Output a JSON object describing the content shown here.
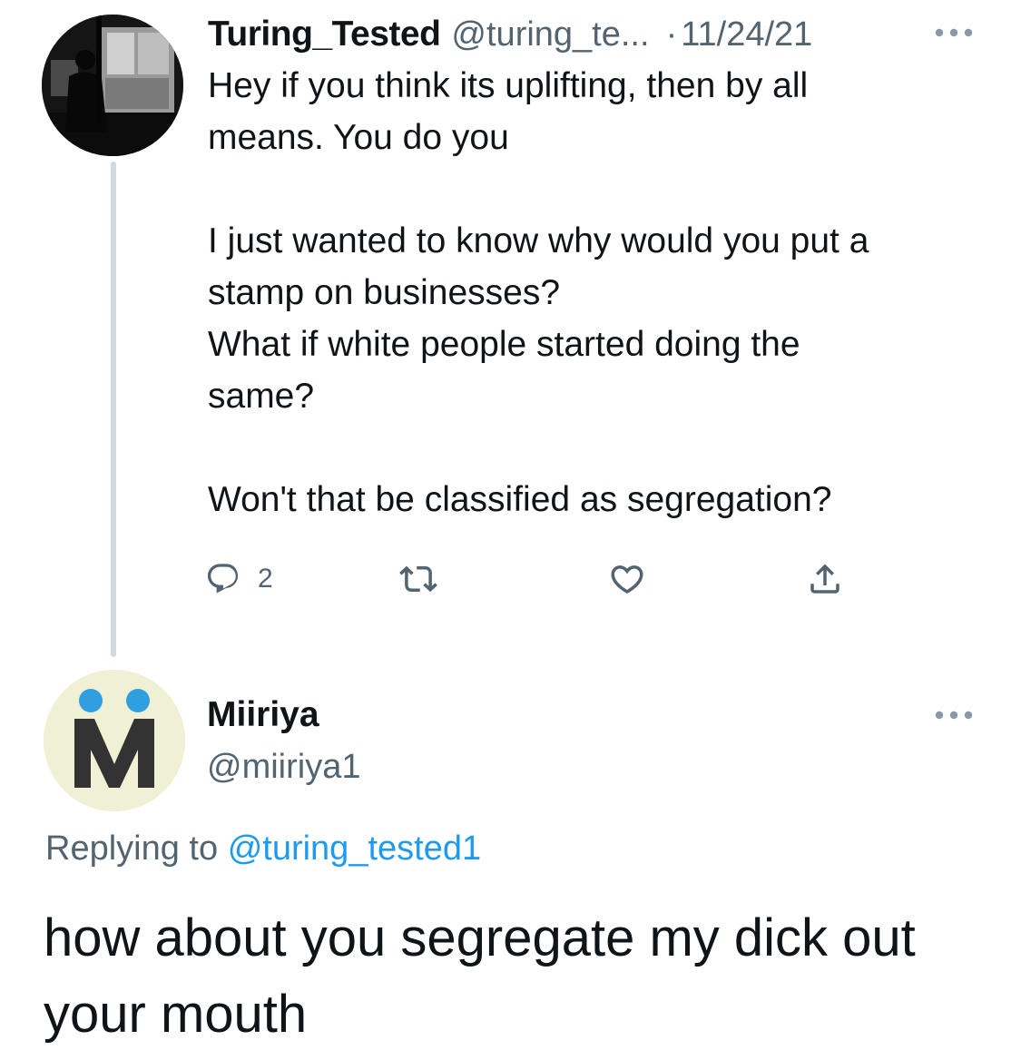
{
  "tweet1": {
    "display_name": "Turing_Tested",
    "handle": "@turing_te...",
    "separator": "·",
    "date": "11/24/21",
    "more_icon": "more-horizontal-icon",
    "text": "Hey if you think its uplifting, then by all\nmeans. You do you\n\nI just wanted to know why would you put a\nstamp on businesses?\nWhat if white people started doing the\nsame?\n\nWon't that be classified as segregation?",
    "actions": {
      "reply_icon": "reply-icon",
      "reply_count": "2",
      "retweet_icon": "retweet-icon",
      "like_icon": "heart-icon",
      "share_icon": "share-icon"
    }
  },
  "tweet2": {
    "display_name": "Miiriya",
    "handle": "@miiriya1",
    "more_icon": "more-horizontal-icon",
    "replying_label": "Replying to",
    "replying_to": "@turing_tested1",
    "text": "how about you segregate my dick out your mouth"
  },
  "colors": {
    "text_primary": "#0f1419",
    "text_secondary": "#536471",
    "link": "#1d9bf0",
    "thread_line": "#cfd9de",
    "avatar2_bg": "#f0f0d4",
    "avatar2_dots": "#2f9fe0",
    "avatar2_letter": "#333333"
  }
}
